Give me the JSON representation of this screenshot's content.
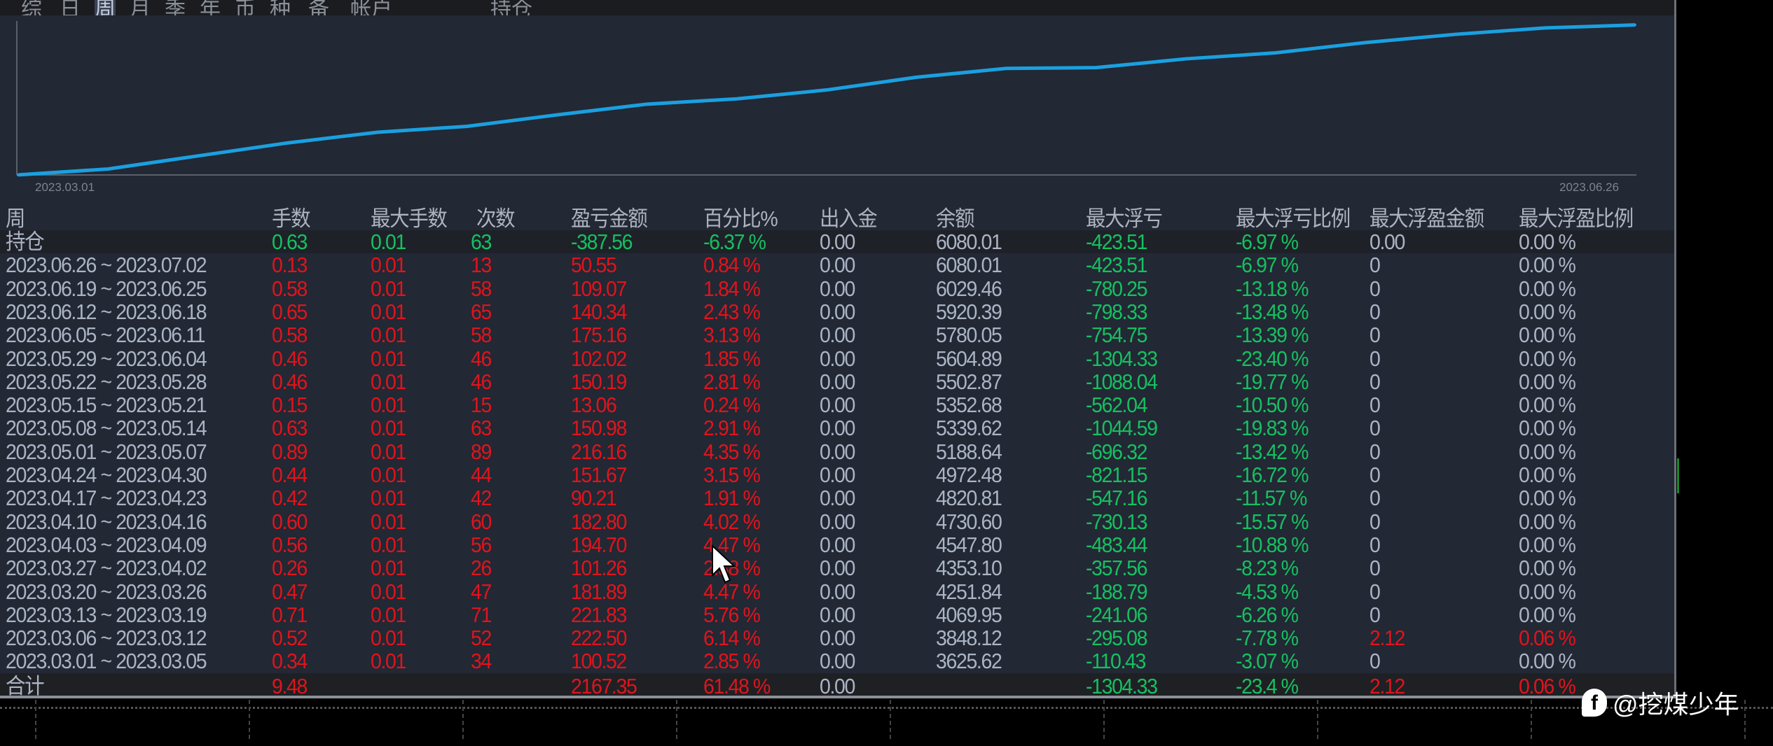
{
  "tabs": [
    "综",
    "日",
    "周",
    "月",
    "季",
    "年",
    "币",
    "种",
    "备",
    "帐户",
    "持仓"
  ],
  "active_tab": "周",
  "chart_data": {
    "type": "line",
    "title": "",
    "x_start_label": "2023.03.01",
    "x_end_label": "2023.06.26",
    "series": [
      {
        "name": "余额",
        "color": "#1aa0e0",
        "values": [
          3525.1,
          3625.62,
          3848.12,
          4069.95,
          4251.84,
          4353.1,
          4547.8,
          4730.6,
          4820.81,
          4972.48,
          5188.64,
          5339.62,
          5352.68,
          5502.87,
          5604.89,
          5780.05,
          5920.39,
          6029.46,
          6080.01
        ]
      }
    ],
    "ylim": [
      3500,
      6100
    ]
  },
  "table": {
    "headers": [
      "周",
      "手数",
      "最大手数",
      "次数",
      "盈亏金额",
      "百分比%",
      "出入金",
      "余额",
      "最大浮亏",
      "最大浮亏比例",
      "最大浮盈金额",
      "最大浮盈比例"
    ],
    "holding": {
      "label": "持仓",
      "lots": "0.63",
      "max_lot": "0.01",
      "count": "63",
      "pl": "-387.56",
      "pct": "-6.37 %",
      "io": "0.00",
      "balance": "6080.01",
      "max_dd": "-423.51",
      "max_dd_pct": "-6.97 %",
      "max_fp": "0.00",
      "max_fp_pct": "0.00 %"
    },
    "rows": [
      {
        "week": "2023.06.26 ~ 2023.07.02",
        "lots": "0.13",
        "max_lot": "0.01",
        "count": "13",
        "pl": "50.55",
        "pct": "0.84 %",
        "io": "0.00",
        "balance": "6080.01",
        "max_dd": "-423.51",
        "max_dd_pct": "-6.97 %",
        "max_fp": "0",
        "max_fp_pct": "0.00 %"
      },
      {
        "week": "2023.06.19 ~ 2023.06.25",
        "lots": "0.58",
        "max_lot": "0.01",
        "count": "58",
        "pl": "109.07",
        "pct": "1.84 %",
        "io": "0.00",
        "balance": "6029.46",
        "max_dd": "-780.25",
        "max_dd_pct": "-13.18 %",
        "max_fp": "0",
        "max_fp_pct": "0.00 %"
      },
      {
        "week": "2023.06.12 ~ 2023.06.18",
        "lots": "0.65",
        "max_lot": "0.01",
        "count": "65",
        "pl": "140.34",
        "pct": "2.43 %",
        "io": "0.00",
        "balance": "5920.39",
        "max_dd": "-798.33",
        "max_dd_pct": "-13.48 %",
        "max_fp": "0",
        "max_fp_pct": "0.00 %"
      },
      {
        "week": "2023.06.05 ~ 2023.06.11",
        "lots": "0.58",
        "max_lot": "0.01",
        "count": "58",
        "pl": "175.16",
        "pct": "3.13 %",
        "io": "0.00",
        "balance": "5780.05",
        "max_dd": "-754.75",
        "max_dd_pct": "-13.39 %",
        "max_fp": "0",
        "max_fp_pct": "0.00 %"
      },
      {
        "week": "2023.05.29 ~ 2023.06.04",
        "lots": "0.46",
        "max_lot": "0.01",
        "count": "46",
        "pl": "102.02",
        "pct": "1.85 %",
        "io": "0.00",
        "balance": "5604.89",
        "max_dd": "-1304.33",
        "max_dd_pct": "-23.40 %",
        "max_fp": "0",
        "max_fp_pct": "0.00 %"
      },
      {
        "week": "2023.05.22 ~ 2023.05.28",
        "lots": "0.46",
        "max_lot": "0.01",
        "count": "46",
        "pl": "150.19",
        "pct": "2.81 %",
        "io": "0.00",
        "balance": "5502.87",
        "max_dd": "-1088.04",
        "max_dd_pct": "-19.77 %",
        "max_fp": "0",
        "max_fp_pct": "0.00 %"
      },
      {
        "week": "2023.05.15 ~ 2023.05.21",
        "lots": "0.15",
        "max_lot": "0.01",
        "count": "15",
        "pl": "13.06",
        "pct": "0.24 %",
        "io": "0.00",
        "balance": "5352.68",
        "max_dd": "-562.04",
        "max_dd_pct": "-10.50 %",
        "max_fp": "0",
        "max_fp_pct": "0.00 %"
      },
      {
        "week": "2023.05.08 ~ 2023.05.14",
        "lots": "0.63",
        "max_lot": "0.01",
        "count": "63",
        "pl": "150.98",
        "pct": "2.91 %",
        "io": "0.00",
        "balance": "5339.62",
        "max_dd": "-1044.59",
        "max_dd_pct": "-19.83 %",
        "max_fp": "0",
        "max_fp_pct": "0.00 %"
      },
      {
        "week": "2023.05.01 ~ 2023.05.07",
        "lots": "0.89",
        "max_lot": "0.01",
        "count": "89",
        "pl": "216.16",
        "pct": "4.35 %",
        "io": "0.00",
        "balance": "5188.64",
        "max_dd": "-696.32",
        "max_dd_pct": "-13.42 %",
        "max_fp": "0",
        "max_fp_pct": "0.00 %"
      },
      {
        "week": "2023.04.24 ~ 2023.04.30",
        "lots": "0.44",
        "max_lot": "0.01",
        "count": "44",
        "pl": "151.67",
        "pct": "3.15 %",
        "io": "0.00",
        "balance": "4972.48",
        "max_dd": "-821.15",
        "max_dd_pct": "-16.72 %",
        "max_fp": "0",
        "max_fp_pct": "0.00 %"
      },
      {
        "week": "2023.04.17 ~ 2023.04.23",
        "lots": "0.42",
        "max_lot": "0.01",
        "count": "42",
        "pl": "90.21",
        "pct": "1.91 %",
        "io": "0.00",
        "balance": "4820.81",
        "max_dd": "-547.16",
        "max_dd_pct": "-11.57 %",
        "max_fp": "0",
        "max_fp_pct": "0.00 %"
      },
      {
        "week": "2023.04.10 ~ 2023.04.16",
        "lots": "0.60",
        "max_lot": "0.01",
        "count": "60",
        "pl": "182.80",
        "pct": "4.02 %",
        "io": "0.00",
        "balance": "4730.60",
        "max_dd": "-730.13",
        "max_dd_pct": "-15.57 %",
        "max_fp": "0",
        "max_fp_pct": "0.00 %"
      },
      {
        "week": "2023.04.03 ~ 2023.04.09",
        "lots": "0.56",
        "max_lot": "0.01",
        "count": "56",
        "pl": "194.70",
        "pct": "4.47 %",
        "io": "0.00",
        "balance": "4547.80",
        "max_dd": "-483.44",
        "max_dd_pct": "-10.88 %",
        "max_fp": "0",
        "max_fp_pct": "0.00 %"
      },
      {
        "week": "2023.03.27 ~ 2023.04.02",
        "lots": "0.26",
        "max_lot": "0.01",
        "count": "26",
        "pl": "101.26",
        "pct": "2.38 %",
        "io": "0.00",
        "balance": "4353.10",
        "max_dd": "-357.56",
        "max_dd_pct": "-8.23 %",
        "max_fp": "0",
        "max_fp_pct": "0.00 %"
      },
      {
        "week": "2023.03.20 ~ 2023.03.26",
        "lots": "0.47",
        "max_lot": "0.01",
        "count": "47",
        "pl": "181.89",
        "pct": "4.47 %",
        "io": "0.00",
        "balance": "4251.84",
        "max_dd": "-188.79",
        "max_dd_pct": "-4.53 %",
        "max_fp": "0",
        "max_fp_pct": "0.00 %"
      },
      {
        "week": "2023.03.13 ~ 2023.03.19",
        "lots": "0.71",
        "max_lot": "0.01",
        "count": "71",
        "pl": "221.83",
        "pct": "5.76 %",
        "io": "0.00",
        "balance": "4069.95",
        "max_dd": "-241.06",
        "max_dd_pct": "-6.26 %",
        "max_fp": "0",
        "max_fp_pct": "0.00 %"
      },
      {
        "week": "2023.03.06 ~ 2023.03.12",
        "lots": "0.52",
        "max_lot": "0.01",
        "count": "52",
        "pl": "222.50",
        "pct": "6.14 %",
        "io": "0.00",
        "balance": "3848.12",
        "max_dd": "-295.08",
        "max_dd_pct": "-7.78 %",
        "max_fp": "2.12",
        "max_fp_pct": "0.06 %"
      },
      {
        "week": "2023.03.01 ~ 2023.03.05",
        "lots": "0.34",
        "max_lot": "0.01",
        "count": "34",
        "pl": "100.52",
        "pct": "2.85 %",
        "io": "0.00",
        "balance": "3625.62",
        "max_dd": "-110.43",
        "max_dd_pct": "-3.07 %",
        "max_fp": "0",
        "max_fp_pct": "0.00 %"
      }
    ],
    "total": {
      "label": "合计",
      "lots": "9.48",
      "pl": "2167.35",
      "pct": "61.48 %",
      "io": "0.00",
      "max_dd": "-1304.33",
      "max_dd_pct": "-23.4 %",
      "max_fp": "2.12",
      "max_fp_pct": "0.06 %"
    }
  },
  "watermark": "@挖煤少年",
  "colors": {
    "profit": "#e0141c",
    "loss": "#16c060",
    "neutral": "#aab4c4",
    "line": "#1aa0e0"
  }
}
